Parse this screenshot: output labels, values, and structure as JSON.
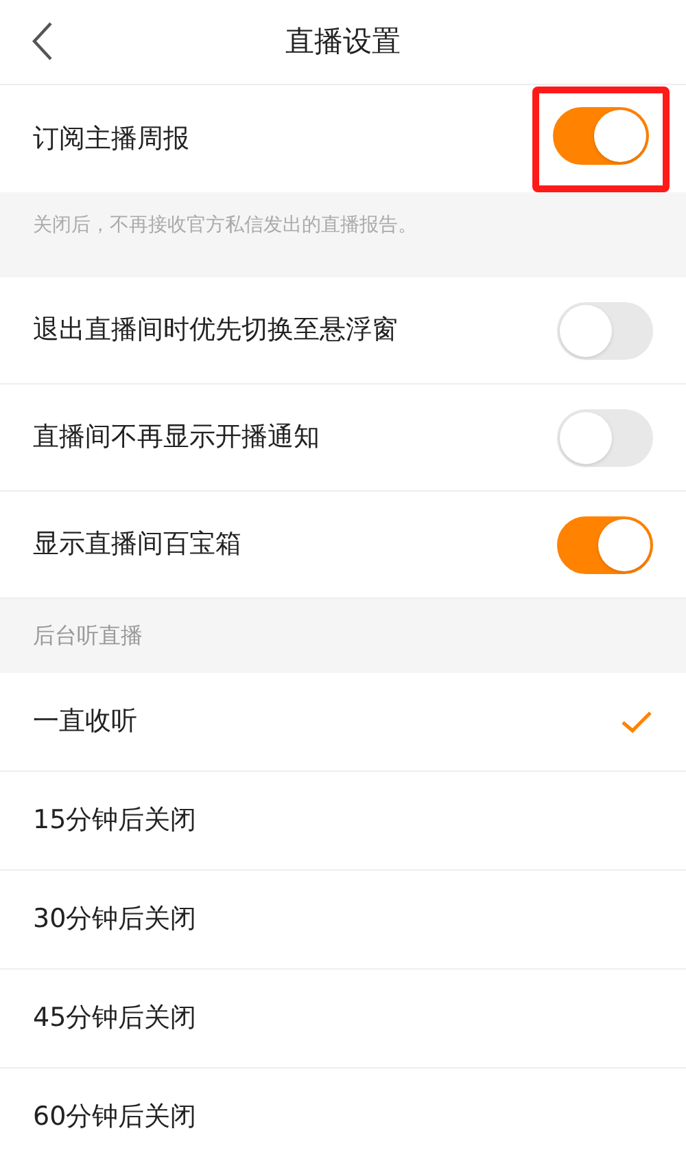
{
  "header": {
    "title": "直播设置"
  },
  "subscribe": {
    "label": "订阅主播周报",
    "on": true,
    "highlighted": true
  },
  "note": "关闭后，不再接收官方私信发出的直播报告。",
  "toggles": [
    {
      "label": "退出直播间时优先切换至悬浮窗",
      "on": false
    },
    {
      "label": "直播间不再显示开播通知",
      "on": false
    },
    {
      "label": "显示直播间百宝箱",
      "on": true
    }
  ],
  "background_section": {
    "title": "后台听直播",
    "options": [
      {
        "label": "一直收听",
        "selected": true
      },
      {
        "label": "15分钟后关闭",
        "selected": false
      },
      {
        "label": "30分钟后关闭",
        "selected": false
      },
      {
        "label": "45分钟后关闭",
        "selected": false
      },
      {
        "label": "60分钟后关闭",
        "selected": false
      }
    ]
  }
}
